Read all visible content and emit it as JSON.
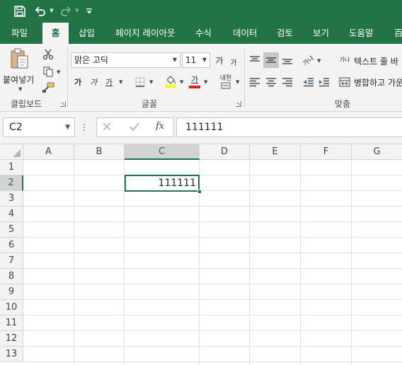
{
  "quick_access": {
    "save_icon": "save-icon",
    "undo_icon": "undo-icon",
    "redo_icon": "redo-icon",
    "customize_icon": "customize-qat-icon"
  },
  "tabs": [
    {
      "label": "파일"
    },
    {
      "label": "홈"
    },
    {
      "label": "삽입"
    },
    {
      "label": "페이지 레이아웃"
    },
    {
      "label": "수식"
    },
    {
      "label": "데이터"
    },
    {
      "label": "검토"
    },
    {
      "label": "보기"
    },
    {
      "label": "도움말"
    },
    {
      "label": "百"
    }
  ],
  "active_tab": "홈",
  "clipboard": {
    "paste_label": "붙여넣기",
    "group_label": "클립보드"
  },
  "font": {
    "font_name": "맑은 고딕",
    "font_size": "11",
    "grow_label": "가",
    "shrink_label": "가",
    "bold_label": "가",
    "italic_label": "가",
    "underline_label": "가",
    "font_color_label": "가",
    "phonetic_label": "내천",
    "group_label": "글꼴"
  },
  "alignment": {
    "wrap_text_label": "텍스트 줄 바",
    "merge_label": "병합하고 가운",
    "orientation_label": "가나",
    "wrap_icon_label": "가나",
    "group_label": "맞춤"
  },
  "formula_bar": {
    "name_box": "C2",
    "cancel_icon": "cancel-icon",
    "enter_icon": "enter-icon",
    "fx_label": "fx",
    "content": "111111"
  },
  "grid": {
    "columns": [
      "A",
      "B",
      "C",
      "D",
      "E",
      "F",
      "G"
    ],
    "selected_column": "C",
    "rows": [
      "1",
      "2",
      "3",
      "4",
      "5",
      "6",
      "7",
      "8",
      "9",
      "10",
      "11",
      "12",
      "13"
    ],
    "selected_row": "2",
    "active_cell_value": "111111"
  },
  "colors": {
    "accent": "#217346",
    "font_color_bar": "#e02020",
    "highlight_bar": "#ffff00"
  }
}
